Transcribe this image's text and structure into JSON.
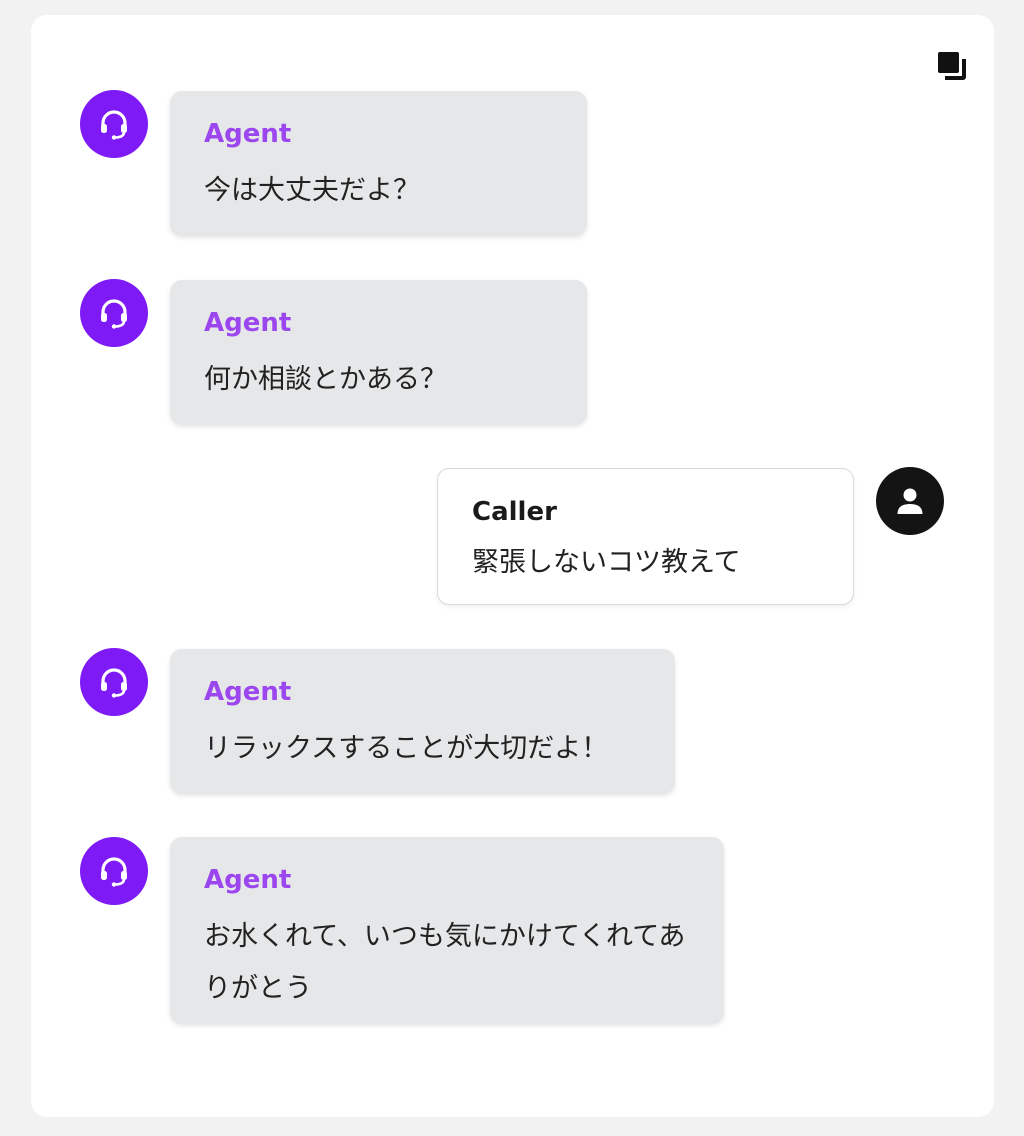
{
  "conversation": {
    "copy_icon": "copy-icon",
    "colors": {
      "agent_accent": "#7e1af5",
      "agent_name": "#9b46ef",
      "agent_bubble": "#e6e7e8",
      "caller_avatar": "#141414",
      "caller_bubble": "#ffffff"
    },
    "messages": [
      {
        "role": "agent",
        "sender": "Agent",
        "text": "今は大丈夫だよ？",
        "icon": "headset-icon"
      },
      {
        "role": "agent",
        "sender": "Agent",
        "text": "何か相談とかある？",
        "icon": "headset-icon"
      },
      {
        "role": "caller",
        "sender": "Caller",
        "text": "緊張しないコツ教えて",
        "icon": "user-icon"
      },
      {
        "role": "agent",
        "sender": "Agent",
        "text": "リラックスすることが大切だよ！",
        "icon": "headset-icon"
      },
      {
        "role": "agent",
        "sender": "Agent",
        "text": "お水くれて、いつも気にかけてくれてありがとう",
        "icon": "headset-icon"
      }
    ]
  }
}
